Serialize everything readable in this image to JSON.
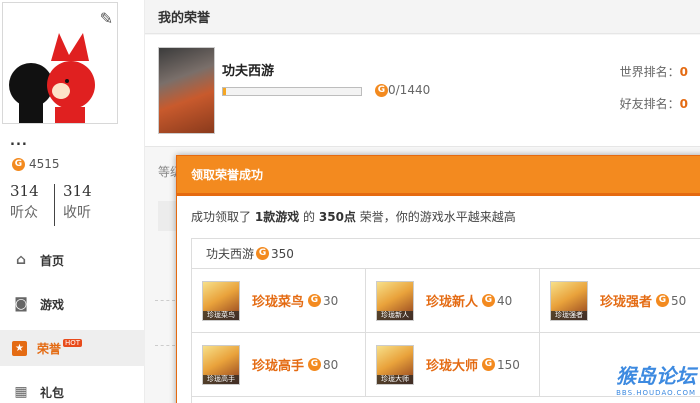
{
  "profile": {
    "nickname": "...",
    "coins": "4515",
    "listeners_count": "314",
    "listeners_label": "听众",
    "following_count": "314",
    "following_label": "收听"
  },
  "nav": [
    {
      "label": "首页",
      "icon": "home-icon"
    },
    {
      "label": "游戏",
      "icon": "gamepad-icon"
    },
    {
      "label": "荣誉",
      "icon": "star-icon",
      "badge": "HOT"
    },
    {
      "label": "礼包",
      "icon": "gift-icon"
    }
  ],
  "main": {
    "title": "我的荣誉",
    "game": {
      "name": "功夫西游",
      "progress_text": "0/1440",
      "progress_fraction": 0.02,
      "world_rank_label": "世界排名：",
      "world_rank_value": "0",
      "friend_rank_label": "好友排名：",
      "friend_rank_value": "0"
    },
    "partial_label": "等级"
  },
  "modal": {
    "title": "领取荣誉成功",
    "msg_prefix": "成功领取了",
    "msg_games": "1款游戏",
    "msg_mid": "的",
    "msg_points": "350点",
    "msg_suffix": "荣誉，你的游戏水平越来越高",
    "reward_game": "功夫西游",
    "reward_points": "350",
    "achievements": [
      {
        "name": "珍珑菜鸟",
        "points": "30",
        "badge": "珍珑菜鸟"
      },
      {
        "name": "珍珑新人",
        "points": "40",
        "badge": "珍珑新人"
      },
      {
        "name": "珍珑强者",
        "points": "50",
        "badge": "珍珑强者"
      },
      {
        "name": "珍珑高手",
        "points": "80",
        "badge": "珍珑高手"
      },
      {
        "name": "珍珑大师",
        "points": "150",
        "badge": "珍珑大师"
      }
    ]
  },
  "watermark": {
    "big": "猴岛论坛",
    "small": "BBS.HOUDAO.COM"
  },
  "colors": {
    "accent": "#f38a1f",
    "accent_dark": "#e46b13",
    "link": "#3d8ae0"
  }
}
